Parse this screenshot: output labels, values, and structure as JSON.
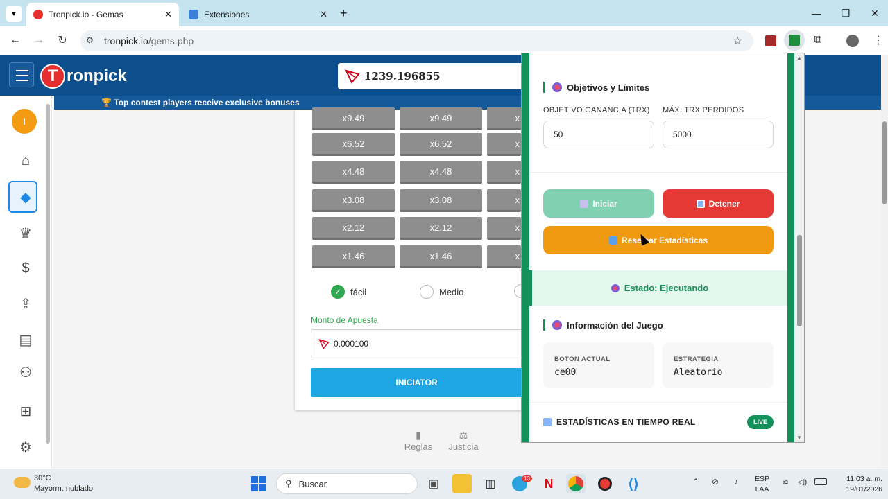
{
  "browser": {
    "tabs": [
      {
        "title": "Tronpick.io - Gemas",
        "active": true
      },
      {
        "title": "Extensiones",
        "active": false
      }
    ],
    "url_host": "tronpick.io",
    "url_path": "/gems.php"
  },
  "site": {
    "logo_initial": "T",
    "logo_text": "ronpick",
    "balance": "1239.196855",
    "promo": "🏆 Top contest players receive exclusive bonuses",
    "user_initial": "I"
  },
  "game": {
    "multipliers": [
      "x9.49",
      "x6.52",
      "x4.48",
      "x3.08",
      "x2.12",
      "x1.46"
    ],
    "col3_partial": "x",
    "difficulty": [
      "fácil",
      "Medio"
    ],
    "bet_label": "Monto de Apuesta",
    "bet_value": "0.000100",
    "start_label": "INICIATOR",
    "footer_links": [
      "Reglas",
      "Justicia"
    ]
  },
  "panel": {
    "goals_title": "Objetivos y Límites",
    "profit_label": "OBJETIVO GANANCIA (TRX)",
    "profit_value": "50",
    "loss_label": "MÁX. TRX PERDIDOS",
    "loss_value": "5000",
    "start_button": "Iniciar",
    "stop_button": "Detener",
    "reset_button": "Resetear Estadísticas",
    "status": "Estado: Ejecutando",
    "game_info_title": "Información del Juego",
    "current_button_label": "BOTÓN ACTUAL",
    "current_button_value": "ce00",
    "strategy_label": "ESTRATEGIA",
    "strategy_value": "Aleatorio",
    "realtime_title": "ESTADÍSTICAS EN TIEMPO REAL",
    "live_badge": "LIVE",
    "colors": {
      "accent": "#12925a",
      "start": "#7fd1b2",
      "stop": "#e53935",
      "reset": "#f09a12"
    }
  },
  "taskbar": {
    "weather_temp": "30°C",
    "weather_desc": "Mayorm. nublado",
    "search_placeholder": "Buscar",
    "lang_top": "ESP",
    "lang_bottom": "LAA",
    "time": "11:03 a. m.",
    "date": "19/01/2026",
    "telegram_badge": "13"
  }
}
